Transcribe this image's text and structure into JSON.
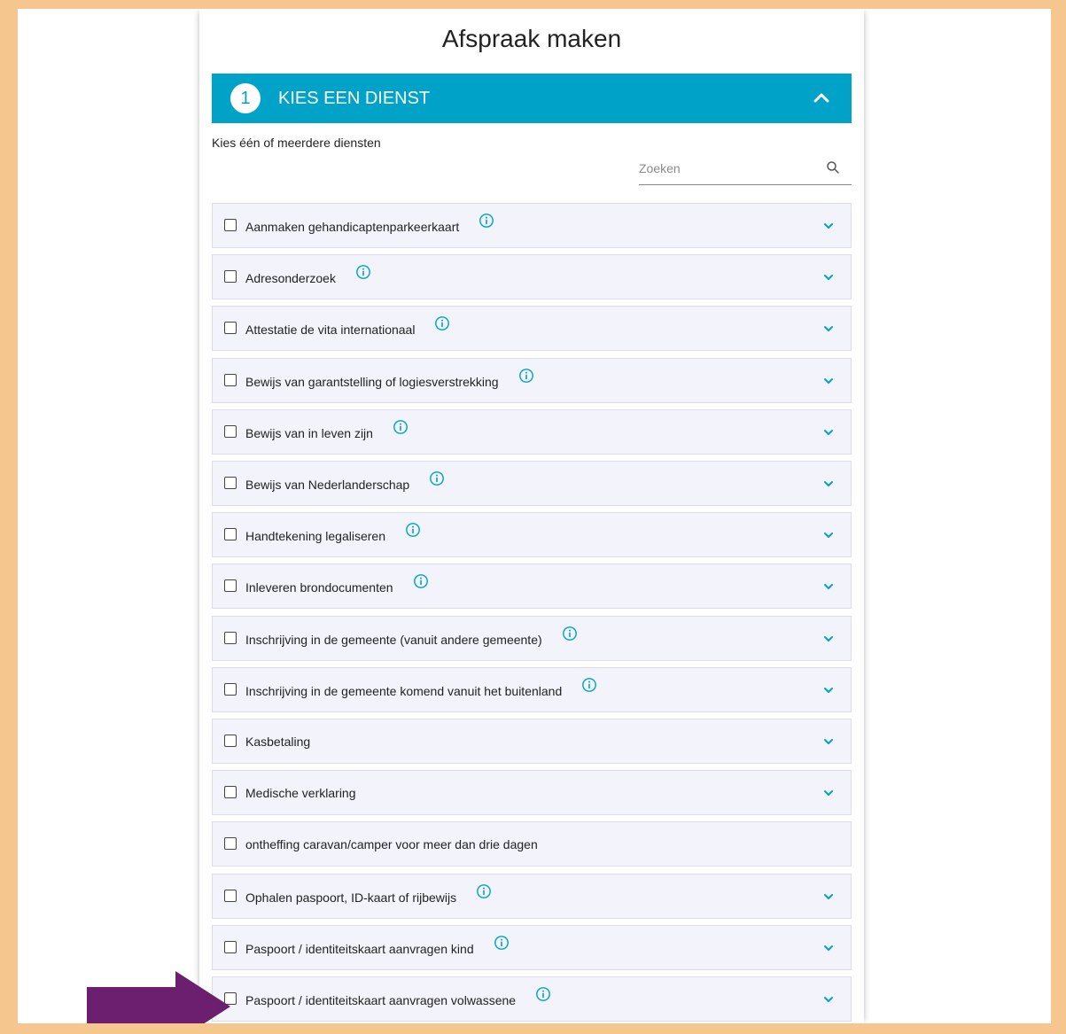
{
  "page": {
    "title": "Afspraak maken",
    "step": {
      "number": "1",
      "label": "KIES EEN DIENST"
    },
    "instruction": "Kies één of meerdere diensten",
    "search": {
      "placeholder": "Zoeken",
      "value": ""
    }
  },
  "services": [
    {
      "label": "Aanmaken gehandicaptenparkeerkaart",
      "info": true,
      "expand": true
    },
    {
      "label": "Adresonderzoek",
      "info": true,
      "expand": true
    },
    {
      "label": "Attestatie de vita internationaal",
      "info": true,
      "expand": true
    },
    {
      "label": "Bewijs van garantstelling of logiesverstrekking",
      "info": true,
      "expand": true
    },
    {
      "label": "Bewijs van in leven zijn",
      "info": true,
      "expand": true
    },
    {
      "label": "Bewijs van Nederlanderschap",
      "info": true,
      "expand": true
    },
    {
      "label": "Handtekening legaliseren",
      "info": true,
      "expand": true
    },
    {
      "label": "Inleveren brondocumenten",
      "info": true,
      "expand": true
    },
    {
      "label": "Inschrijving in de gemeente (vanuit andere gemeente)",
      "info": true,
      "expand": true
    },
    {
      "label": "Inschrijving in de gemeente komend vanuit het buitenland",
      "info": true,
      "expand": true
    },
    {
      "label": "Kasbetaling",
      "info": false,
      "expand": true
    },
    {
      "label": "Medische verklaring",
      "info": false,
      "expand": true
    },
    {
      "label": "ontheffing caravan/camper voor meer dan drie dagen",
      "info": false,
      "expand": false
    },
    {
      "label": "Ophalen paspoort, ID-kaart of rijbewijs",
      "info": true,
      "expand": true
    },
    {
      "label": "Paspoort / identiteitskaart aanvragen kind",
      "info": true,
      "expand": true
    },
    {
      "label": "Paspoort / identiteitskaart aanvragen volwassene",
      "info": true,
      "expand": true
    }
  ],
  "colors": {
    "accent": "#00a3c7",
    "frame": "#f5c78e",
    "row_background": "#f2f3fb",
    "annotation_arrow": "#6b1f6e"
  },
  "icons": {
    "collapse": "chevron-up-icon",
    "search": "search-icon",
    "info": "info-icon",
    "expand": "chevron-down-icon"
  }
}
